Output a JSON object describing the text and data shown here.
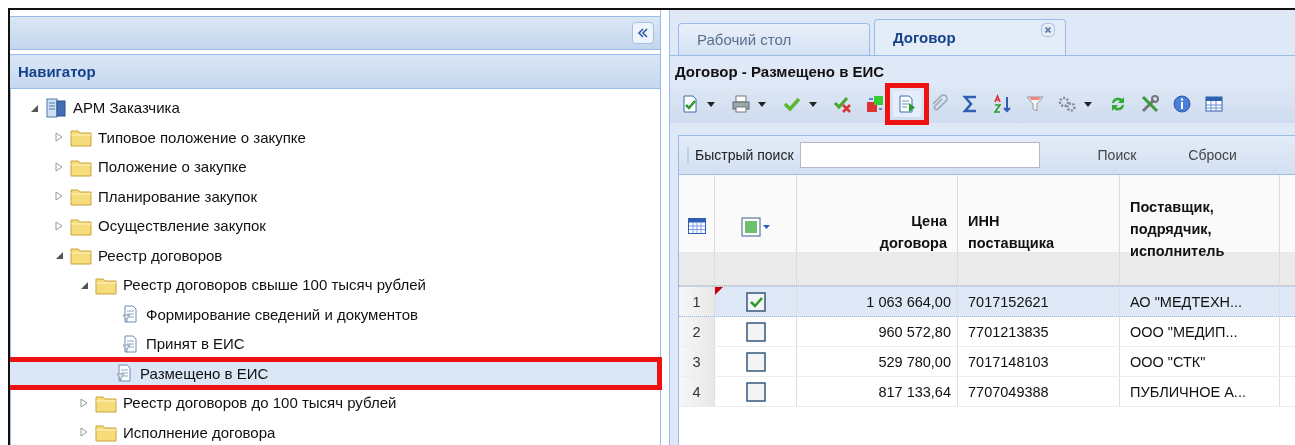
{
  "navigator": {
    "title": "Навигатор",
    "tree": [
      {
        "label": "АРМ Заказчика",
        "kind": "root",
        "expanded": true,
        "selected": false,
        "highlighted": false,
        "children": [
          {
            "label": "Типовое положение о закупке",
            "kind": "folder",
            "expanded": false,
            "selected": false,
            "highlighted": false
          },
          {
            "label": "Положение о закупке",
            "kind": "folder",
            "expanded": false,
            "selected": false,
            "highlighted": false
          },
          {
            "label": "Планирование закупок",
            "kind": "folder",
            "expanded": false,
            "selected": false,
            "highlighted": false
          },
          {
            "label": "Осуществление закупок",
            "kind": "folder",
            "expanded": false,
            "selected": false,
            "highlighted": false
          },
          {
            "label": "Реестр договоров",
            "kind": "folder",
            "expanded": true,
            "selected": false,
            "highlighted": false,
            "children": [
              {
                "label": "Реестр договоров свыше 100 тысяч рублей",
                "kind": "folder",
                "expanded": true,
                "selected": false,
                "highlighted": false,
                "children": [
                  {
                    "label": "Формирование сведений и документов",
                    "kind": "leaf",
                    "selected": false,
                    "highlighted": false
                  },
                  {
                    "label": "Принят в ЕИС",
                    "kind": "leaf",
                    "selected": false,
                    "highlighted": false
                  },
                  {
                    "label": "Размещено в ЕИС",
                    "kind": "leaf",
                    "selected": true,
                    "highlighted": true
                  }
                ]
              },
              {
                "label": "Реестр договоров до 100 тысяч рублей",
                "kind": "folder",
                "expanded": false,
                "selected": false,
                "highlighted": false
              },
              {
                "label": "Исполнение договора",
                "kind": "folder",
                "expanded": false,
                "selected": false,
                "highlighted": false
              }
            ]
          }
        ]
      }
    ]
  },
  "tabs": [
    {
      "label": "Рабочий стол",
      "selected": false,
      "closable": false
    },
    {
      "label": "Договор",
      "selected": true,
      "closable": true
    }
  ],
  "panel_title": "Договор - Размещено в ЕИС",
  "toolbar": [
    {
      "kind": "approve-doc",
      "menu": true,
      "highlighted": false
    },
    {
      "kind": "print",
      "menu": true,
      "highlighted": false
    },
    {
      "kind": "check",
      "menu": true,
      "highlighted": false
    },
    {
      "kind": "uncheck",
      "menu": false,
      "highlighted": false
    },
    {
      "kind": "transfer",
      "menu": false,
      "highlighted": false
    },
    {
      "kind": "doc-run",
      "menu": false,
      "highlighted": true
    },
    {
      "kind": "clip",
      "menu": false,
      "highlighted": false
    },
    {
      "kind": "sigma",
      "menu": false,
      "highlighted": false
    },
    {
      "kind": "sort",
      "menu": false,
      "highlighted": false
    },
    {
      "kind": "filter",
      "menu": false,
      "highlighted": false
    },
    {
      "kind": "gears",
      "menu": true,
      "highlighted": false
    },
    {
      "kind": "refresh",
      "menu": false,
      "highlighted": false
    },
    {
      "kind": "tools",
      "menu": false,
      "highlighted": false
    },
    {
      "kind": "info",
      "menu": false,
      "highlighted": false
    },
    {
      "kind": "table",
      "menu": false,
      "highlighted": false
    }
  ],
  "search": {
    "label": "Быстрый поиск",
    "buttons": [
      "Поиск",
      "Сброси"
    ]
  },
  "grid": {
    "columns": [
      "Цена договора",
      "ИНН поставщика",
      "Поставщик, подрядчик, исполнитель"
    ],
    "rows": [
      {
        "num": "1",
        "checked": true,
        "selected": true,
        "modified": true,
        "price": "1 063 664,00",
        "inn": "7017152621",
        "supplier": "АО \"МЕДТЕХН..."
      },
      {
        "num": "2",
        "checked": false,
        "selected": false,
        "modified": false,
        "price": "960 572,80",
        "inn": "7701213835",
        "supplier": "ООО \"МЕДИП..."
      },
      {
        "num": "3",
        "checked": false,
        "selected": false,
        "modified": false,
        "price": "529 780,00",
        "inn": "7017148103",
        "supplier": "ООО \"СТК\""
      },
      {
        "num": "4",
        "checked": false,
        "selected": false,
        "modified": false,
        "price": "817 133,64",
        "inn": "7707049388",
        "supplier": "ПУБЛИЧНОЕ А..."
      }
    ]
  }
}
